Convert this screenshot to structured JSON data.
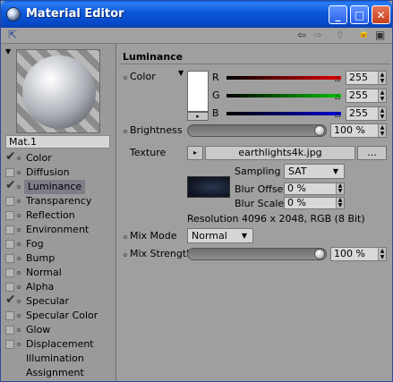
{
  "window": {
    "title": "Material Editor",
    "minimize_glyph": "_",
    "maximize_glyph": "□",
    "close_glyph": "✕"
  },
  "toolbar": {
    "pin_glyph": "⇱",
    "back_glyph": "⇦",
    "forward_glyph": "⇨",
    "up_glyph": "⇧",
    "lock_glyph": "🔓",
    "new_window_glyph": "▣"
  },
  "material": {
    "name": "Mat.1"
  },
  "channels": [
    {
      "label": "Color",
      "checked": true
    },
    {
      "label": "Diffusion",
      "checked": false
    },
    {
      "label": "Luminance",
      "checked": true,
      "selected": true
    },
    {
      "label": "Transparency",
      "checked": false
    },
    {
      "label": "Reflection",
      "checked": false
    },
    {
      "label": "Environment",
      "checked": false
    },
    {
      "label": "Fog",
      "checked": false
    },
    {
      "label": "Bump",
      "checked": false
    },
    {
      "label": "Normal",
      "checked": false
    },
    {
      "label": "Alpha",
      "checked": false
    },
    {
      "label": "Specular",
      "checked": true
    },
    {
      "label": "Specular Color",
      "checked": false
    },
    {
      "label": "Glow",
      "checked": false
    },
    {
      "label": "Displacement",
      "checked": false
    },
    {
      "label": "Illumination",
      "checked": null
    },
    {
      "label": "Assignment",
      "checked": null
    }
  ],
  "luminance": {
    "header": "Luminance",
    "color_label": "Color",
    "color_value": "#ffffff",
    "r_label": "R",
    "g_label": "G",
    "b_label": "B",
    "r_value": "255",
    "g_value": "255",
    "b_value": "255",
    "brightness_label": "Brightness",
    "brightness_value": "100 %",
    "texture_label": "Texture",
    "texture_file": "earthlights4k.jpg",
    "texture_browse": "...",
    "sampling_label": "Sampling",
    "sampling_value": "SAT",
    "blur_offset_label": "Blur Offset",
    "blur_offset_value": "0 %",
    "blur_scale_label": "Blur Scale",
    "blur_scale_value": "0 %",
    "resolution_text": "Resolution 4096 x 2048, RGB (8 Bit)",
    "mix_mode_label": "Mix Mode",
    "mix_mode_value": "Normal",
    "mix_strength_label": "Mix Strength",
    "mix_strength_value": "100 %"
  },
  "colors": {
    "titlebar": "#0b57d8",
    "r_slider": "#e00000",
    "g_slider": "#00c000",
    "b_slider": "#0000d0",
    "selection": "#7d7d87"
  }
}
